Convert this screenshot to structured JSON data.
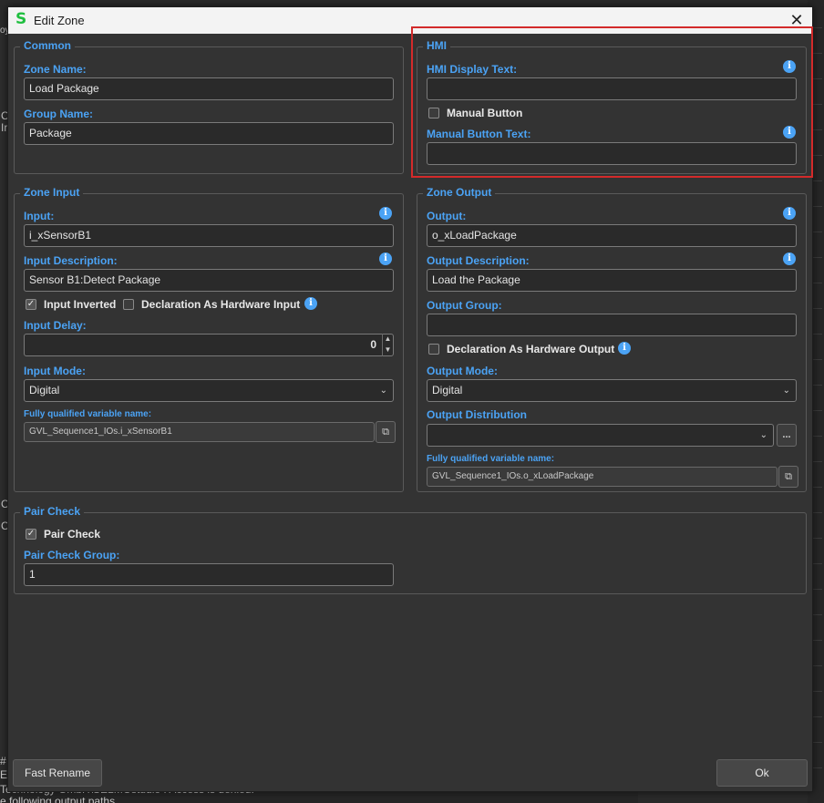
{
  "window": {
    "title": "Edit Zone",
    "logo": "S"
  },
  "background": {
    "fragments": [
      "oy",
      "C",
      "Ir",
      "C",
      "C",
      "#",
      "Ex",
      "Technology GmbH\\SELMOstudio : Access is denied.",
      "e following output paths"
    ]
  },
  "common": {
    "title": "Common",
    "zone_name_label": "Zone Name:",
    "zone_name_value": "Load Package",
    "group_name_label": "Group Name:",
    "group_name_value": "Package"
  },
  "hmi": {
    "title": "HMI",
    "display_text_label": "HMI Display Text:",
    "display_text_value": "",
    "manual_button_label": "Manual Button",
    "manual_button_checked": false,
    "manual_button_text_label": "Manual Button Text:",
    "manual_button_text_value": ""
  },
  "zone_input": {
    "title": "Zone Input",
    "input_label": "Input:",
    "input_value": "i_xSensorB1",
    "description_label": "Input Description:",
    "description_value": "Sensor B1:Detect Package",
    "inverted_label": "Input Inverted",
    "inverted_checked": true,
    "hw_label": "Declaration As Hardware Input",
    "hw_checked": false,
    "delay_label": "Input Delay:",
    "delay_value": "0",
    "mode_label": "Input Mode:",
    "mode_value": "Digital",
    "fqn_label": "Fully qualified variable name:",
    "fqn_value": "GVL_Sequence1_IOs.i_xSensorB1"
  },
  "zone_output": {
    "title": "Zone Output",
    "output_label": "Output:",
    "output_value": "o_xLoadPackage",
    "description_label": "Output Description:",
    "description_value": "Load the Package",
    "group_label": "Output Group:",
    "group_value": "",
    "hw_label": "Declaration As Hardware Output",
    "hw_checked": false,
    "mode_label": "Output Mode:",
    "mode_value": "Digital",
    "distribution_label": "Output Distribution",
    "distribution_value": "",
    "more_label": "...",
    "fqn_label": "Fully qualified variable name:",
    "fqn_value": "GVL_Sequence1_IOs.o_xLoadPackage"
  },
  "pair_check": {
    "title": "Pair Check",
    "checkbox_label": "Pair Check",
    "checked": true,
    "group_label": "Pair Check Group:",
    "group_value": "1"
  },
  "buttons": {
    "fast_rename": "Fast Rename",
    "ok": "Ok"
  },
  "glyphs": {
    "close": "✕",
    "info": "i",
    "check": "✓",
    "chevron": "⌄",
    "up": "▲",
    "down": "▼",
    "copy": "⧉"
  },
  "colors": {
    "accent": "#4ba3f5",
    "highlight": "#d32a2a",
    "logo": "#1fbf3f"
  }
}
